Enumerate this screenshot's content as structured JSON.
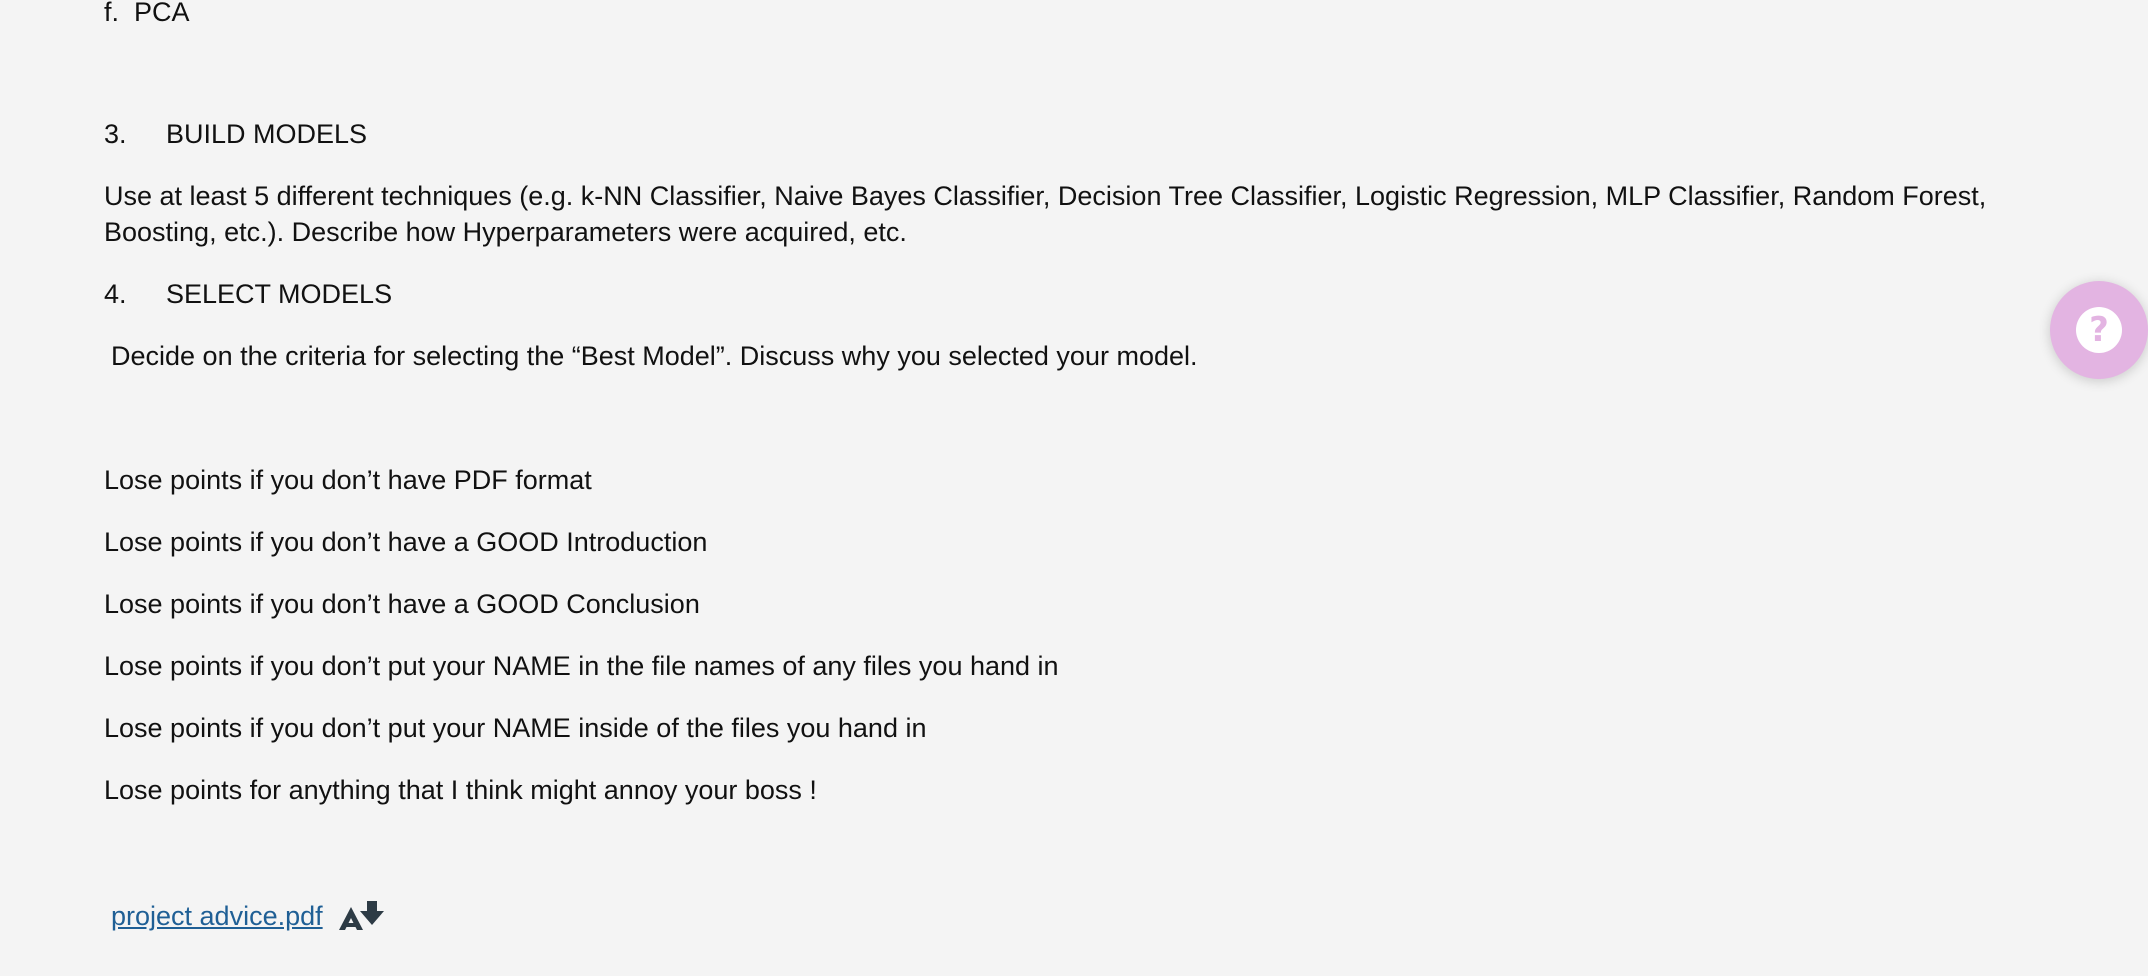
{
  "list_item_f": {
    "marker": "f.",
    "text": "PCA"
  },
  "section3": {
    "number": "3.",
    "title": "BUILD MODELS",
    "body": "Use at least 5 different techniques (e.g. k-NN Classifier, Naive Bayes Classifier, Decision Tree Classifier, Logistic Regression, MLP Classifier, Random Forest, Boosting, etc.). Describe how Hyperparameters were acquired, etc."
  },
  "section4": {
    "number": "4.",
    "title": "SELECT MODELS",
    "body": "Decide on the criteria for selecting the “Best Model”. Discuss why you selected your model."
  },
  "penalties": [
    "Lose points if you don’t have PDF format",
    "Lose points if you don’t have a GOOD Introduction",
    "Lose points if you don’t have a GOOD Conclusion",
    "Lose points if you don’t put your NAME in the file names of any files you hand in",
    "Lose points if you don’t put your NAME inside of the files you hand in",
    "Lose points for anything that I think might annoy your boss !"
  ],
  "attachment": {
    "filename": "project advice.pdf",
    "icon": "accessibility-alternative-formats-icon"
  },
  "help_button": {
    "icon": "question-mark-icon",
    "color": "#e3b4e2"
  },
  "colors": {
    "background": "#f4f4f4",
    "text": "#111111",
    "link": "#1f5f95"
  }
}
